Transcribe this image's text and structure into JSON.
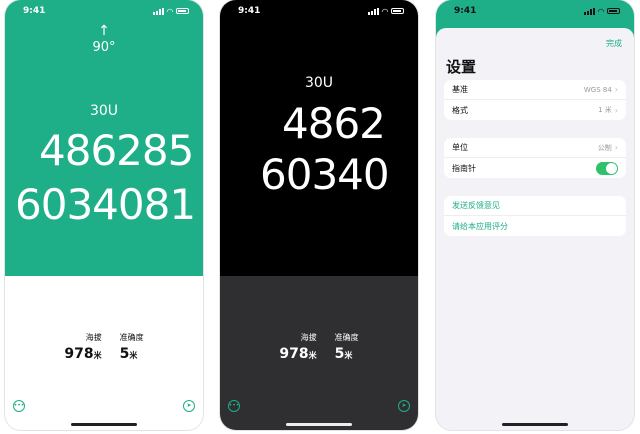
{
  "status_time": "9:41",
  "accent_color": "#1eae88",
  "screen_light": {
    "heading_arrow": "↑",
    "heading": "90°",
    "zone": "30U",
    "easting": "486285",
    "northing": "6034081",
    "altitude_label": "海拔",
    "altitude_value": "978",
    "altitude_unit": "米",
    "accuracy_label": "准确度",
    "accuracy_value": "5",
    "accuracy_unit": "米"
  },
  "screen_dark": {
    "zone": "30U",
    "easting": "4862",
    "northing": "60340",
    "altitude_label": "海拔",
    "altitude_value": "978",
    "altitude_unit": "米",
    "accuracy_label": "准确度",
    "accuracy_value": "5",
    "accuracy_unit": "米"
  },
  "settings": {
    "done": "完成",
    "title": "设置",
    "datum_label": "基准",
    "datum_value": "WGS 84",
    "format_label": "格式",
    "format_value": "1 米",
    "units_label": "单位",
    "units_value": "公制",
    "compass_label": "指南针",
    "feedback_link": "发送反馈意见",
    "rate_link": "请给本应用评分"
  },
  "icons": {
    "more": "more-icon",
    "locate": "locate-icon"
  }
}
